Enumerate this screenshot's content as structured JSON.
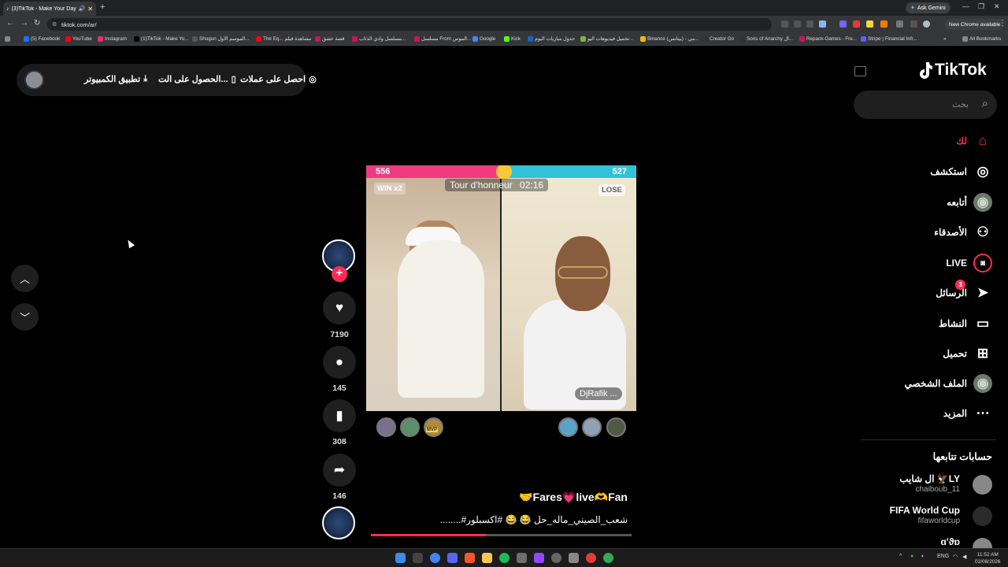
{
  "browser": {
    "tab_title": "(3)TikTok - Make Your Day",
    "new_tab": "+",
    "ask_gemini": "Ask Gemini",
    "url": "tiktok.com/ar/",
    "new_chrome": "New Chrome available",
    "all_bookmarks": "All Bookmarks",
    "bookmarks": [
      {
        "label": "(5) Facebook",
        "color": "#1877f2"
      },
      {
        "label": "YouTube",
        "color": "#ff0000"
      },
      {
        "label": "Instagram",
        "color": "#e1306c"
      },
      {
        "label": "(1)TikTok - Make Yo...",
        "color": "#000000"
      },
      {
        "label": "Shogun الموسم الاول...",
        "color": "#555555"
      },
      {
        "label": "The Eq... مشاهدة فيلم",
        "color": "#e50914"
      },
      {
        "label": "قصة عشق",
        "color": "#c2185b"
      },
      {
        "label": "مسلسل وادي الذئاب...",
        "color": "#c2185b"
      },
      {
        "label": "مسلسل From الموس...",
        "color": "#c2185b"
      },
      {
        "label": "Google",
        "color": "#4285f4"
      },
      {
        "label": "Kick",
        "color": "#53fc18"
      },
      {
        "label": "جدول مباريات اليوم",
        "color": "#1565c0"
      },
      {
        "label": "تحميل فيديوهات اليو...",
        "color": "#7cb342"
      },
      {
        "label": "Binance (بينانس) - مي...",
        "color": "#f0b90b"
      },
      {
        "label": "Creator Go",
        "color": "#333333"
      },
      {
        "label": "Sons of Anarchy ال...",
        "color": "#333333"
      },
      {
        "label": "Repack-Games - Fre...",
        "color": "#c2185b"
      },
      {
        "label": "Stripe | Financial Infr...",
        "color": "#635bff"
      }
    ]
  },
  "top_pill": {
    "effects": "احصل على عملات",
    "get_app": "الحصول على الت...",
    "desktop_app": "تطبيق الكمبيوتر"
  },
  "video": {
    "score_left": "556",
    "score_right": "527",
    "win_tag": "WIN x2",
    "lose_tag": "LOSE",
    "round_title": "Tour d'honneur",
    "timer": "02:16",
    "opponent_name": "DjRafik ...",
    "mvp_label": "MVP",
    "progress": 0.44
  },
  "actions": {
    "likes": "7190",
    "comments": "145",
    "saves": "308",
    "shares": "146"
  },
  "caption": {
    "title": "🤝Fares💗live🫶Fan",
    "hashtags": "........#شعب_الصيني_ماله_حل 😂 😂 #اكسبلور"
  },
  "sidebar": {
    "logo": "TikTok",
    "search_placeholder": "بحث",
    "nav": [
      {
        "label": "لك",
        "icon": "home-icon",
        "active": true
      },
      {
        "label": "استكشف",
        "icon": "compass-icon"
      },
      {
        "label": "أتابعه",
        "icon": "following-avatar-icon"
      },
      {
        "label": "الأصدقاء",
        "icon": "friends-icon"
      },
      {
        "label": "LIVE",
        "icon": "live-icon"
      },
      {
        "label": "الرسائل",
        "icon": "messages-icon",
        "badge": "3"
      },
      {
        "label": "النشاط",
        "icon": "activity-icon"
      },
      {
        "label": "تحميل",
        "icon": "upload-icon"
      },
      {
        "label": "الملف الشخصي",
        "icon": "profile-icon"
      },
      {
        "label": "المزيد",
        "icon": "more-icon"
      }
    ],
    "following_title": "حسابات تتابعها",
    "accounts": [
      {
        "name": "ال شايب 🦅LY",
        "handle": "chaiboub_11"
      },
      {
        "name": "FIFA World Cup",
        "handle": "fifaworldcup"
      },
      {
        "name": "ɑ'ϑɒ",
        "handle": ""
      }
    ]
  },
  "taskbar": {
    "lang": "ENG",
    "time": "11:52 AM",
    "date": "02/08/2026"
  },
  "colors": {
    "accent": "#fe2c55",
    "score_left": "#f03a7f",
    "score_right": "#31c2d9"
  }
}
